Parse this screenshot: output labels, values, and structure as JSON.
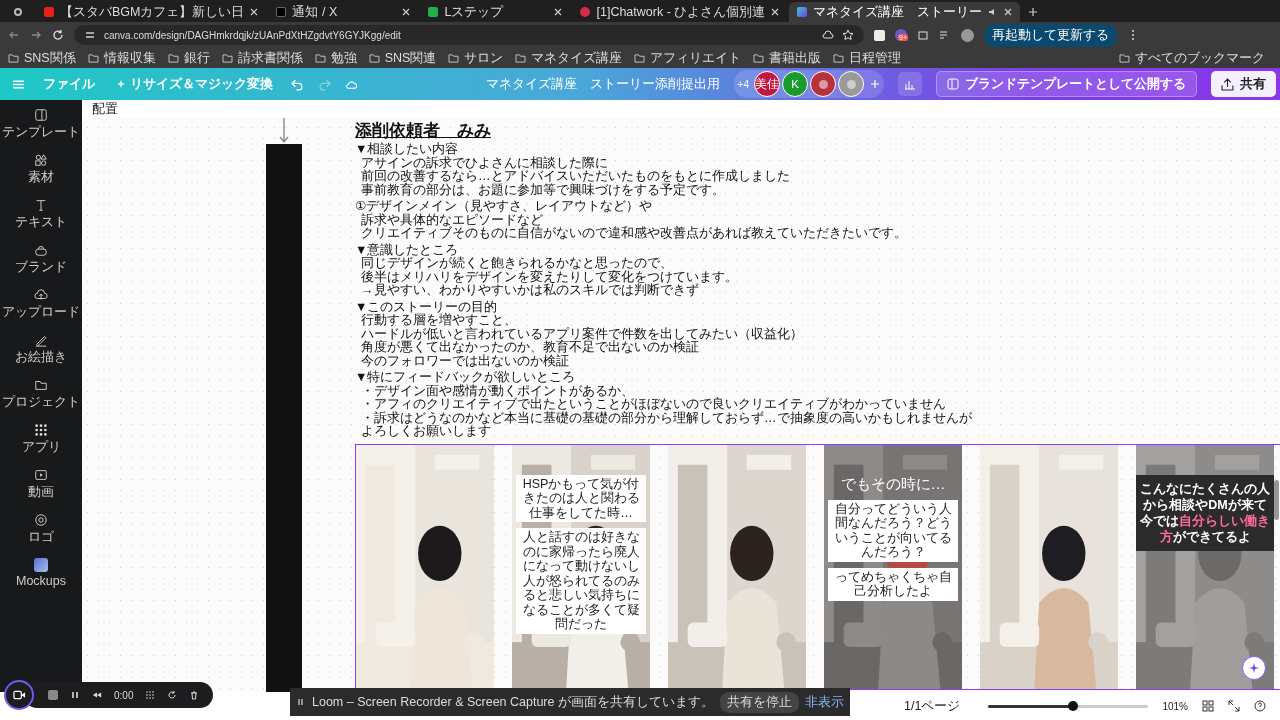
{
  "browser": {
    "tabs": [
      {
        "label": "【スタバBGMカフェ】新しい日",
        "kind": "video",
        "selected": false
      },
      {
        "label": "通知 / X",
        "kind": "x",
        "selected": false
      },
      {
        "label": "Lステップ",
        "kind": "gear",
        "selected": false
      },
      {
        "label": "[1]Chatwork - ひよさん個別連",
        "kind": "dots",
        "selected": false
      },
      {
        "label": "マネタイズ講座　ストーリー",
        "kind": "canva",
        "selected": true
      }
    ],
    "url": "canva.com/design/DAGHmkrdqjk/zUAnPdXtHZgdvtY6GYJKgg/edit",
    "extension_badge": "9+",
    "update_button": "再起動して更新する",
    "bookmarks": [
      "SNS関係",
      "情報収集",
      "銀行",
      "請求書関係",
      "勉強",
      "SNS関連",
      "サロン",
      "マネタイズ講座",
      "アフィリエイト",
      "書籍出版",
      "日程管理"
    ],
    "all_bookmarks": "すべてのブックマーク"
  },
  "toolbar": {
    "file_menu": "ファイル",
    "resize_button": "リサイズ＆マジック変換",
    "design_title": "マネタイズ講座　ストーリー添削提出用",
    "more_collaborators": "+4",
    "avatars": [
      {
        "kind": "text",
        "label": "美佳",
        "color": "#c2173f"
      },
      {
        "kind": "text",
        "label": "K",
        "color": "#1b9a2e"
      },
      {
        "kind": "picture",
        "color": "#b8323c"
      },
      {
        "kind": "picture",
        "color": "#9a9a9a"
      }
    ],
    "publish_button": "ブランドテンプレートとして公開する",
    "share_button": "共有"
  },
  "sidebar": [
    {
      "kind": "template",
      "label": "テンプレート"
    },
    {
      "kind": "elements",
      "label": "素材"
    },
    {
      "kind": "text",
      "label": "テキスト"
    },
    {
      "kind": "brand",
      "label": "ブランド"
    },
    {
      "kind": "upload",
      "label": "アップロード"
    },
    {
      "kind": "draw",
      "label": "お絵描き"
    },
    {
      "kind": "folder",
      "label": "プロジェクト"
    },
    {
      "kind": "apps",
      "label": "アプリ"
    },
    {
      "kind": "video",
      "label": "動画"
    },
    {
      "kind": "logo",
      "label": "ロゴ"
    },
    {
      "kind": "mockups",
      "label": "Mockups"
    }
  ],
  "canvas_header": "配置",
  "document": {
    "title": "添削依頼者　みみ",
    "sections": [
      {
        "heading": "▼相談したい内容",
        "lines": [
          "アサインの訴求でひよさんに相談した際に",
          "前回の改善するなら…とアドバイスいただいたものをもとに作成しました",
          "事前教育の部分は、お題に参加等で興味づけをする予定です。"
        ]
      },
      {
        "heading": "①デザインメイン（見やすさ、レイアウトなど）や",
        "lines": [
          "訴求や具体的なエピソードなど",
          "クリエイティブそのものに自信がないので違和感や改善点があれば教えていただきたいです。"
        ]
      },
      {
        "heading": "▼意識したところ",
        "lines": [
          "同じデザインが続くと飽きられるかなと思ったので、",
          "後半はメリハリをデザインを変えたりして変化をつけています。",
          "→見やすい、わかりやすいかは私のスキルでは判断できず"
        ]
      },
      {
        "heading": "▼このストーリーの目的",
        "lines": [
          "行動する層を増やすこと、",
          "ハードルが低いと言われているアプリ案件で件数を出してみたい（収益化）",
          "角度が悪くて出なかったのか、教育不足で出ないのか検証",
          "今のフォロワーでは出ないのか検証"
        ]
      },
      {
        "heading": "▼特にフィードバックが欲しいところ",
        "lines": [
          "・デザイン面や感情が動くポイントがあるか、",
          "・アフィのクリエイティブで出たということがほぼないので良いクリエイティブがわかっていません",
          "・訴求はどうなのかなど本当に基礎の基礎の部分から理解しておらず…で抽象度の高いかもしれませんが",
          "よろしくお願いします"
        ]
      }
    ]
  },
  "pages": [
    {
      "kind": "picture"
    },
    {
      "kind": "picture",
      "captions": [
        {
          "kind": "box",
          "text": "HSPかもって気が付きたのは人と関わる仕事をしてた時…"
        },
        {
          "kind": "box",
          "text": "人と話すのは好きなのに家帰ったら廃人になって動けないし人が怒られてるのみると悲しい気持ちになることが多くて疑問だった"
        }
      ]
    },
    {
      "kind": "picture"
    },
    {
      "kind": "picture",
      "captions": [
        {
          "kind": "title",
          "text": "でもその時に…"
        },
        {
          "kind": "box",
          "text": "自分ってどういう人間なんだろう？どういうことが向いてるんだろう？"
        },
        {
          "kind": "box",
          "text": "ってめちゃくちゃ自己分析したよ"
        }
      ]
    },
    {
      "kind": "picture"
    },
    {
      "kind": "picture",
      "captions": [
        {
          "kind": "band",
          "text": "こんなにたくさんの人から相談やDMが来て今では**自分らしい働き方**ができてるよ"
        }
      ]
    }
  ],
  "loom": {
    "timer": "0:00",
    "notice": "Loom – Screen Recorder & Screen Capture が画面を共有しています。",
    "stop_button": "共有を停止",
    "hide_link": "非表示"
  },
  "status": {
    "page_count": "1/1ページ",
    "zoom": {
      "level": 0.53,
      "reading": "101%"
    }
  }
}
